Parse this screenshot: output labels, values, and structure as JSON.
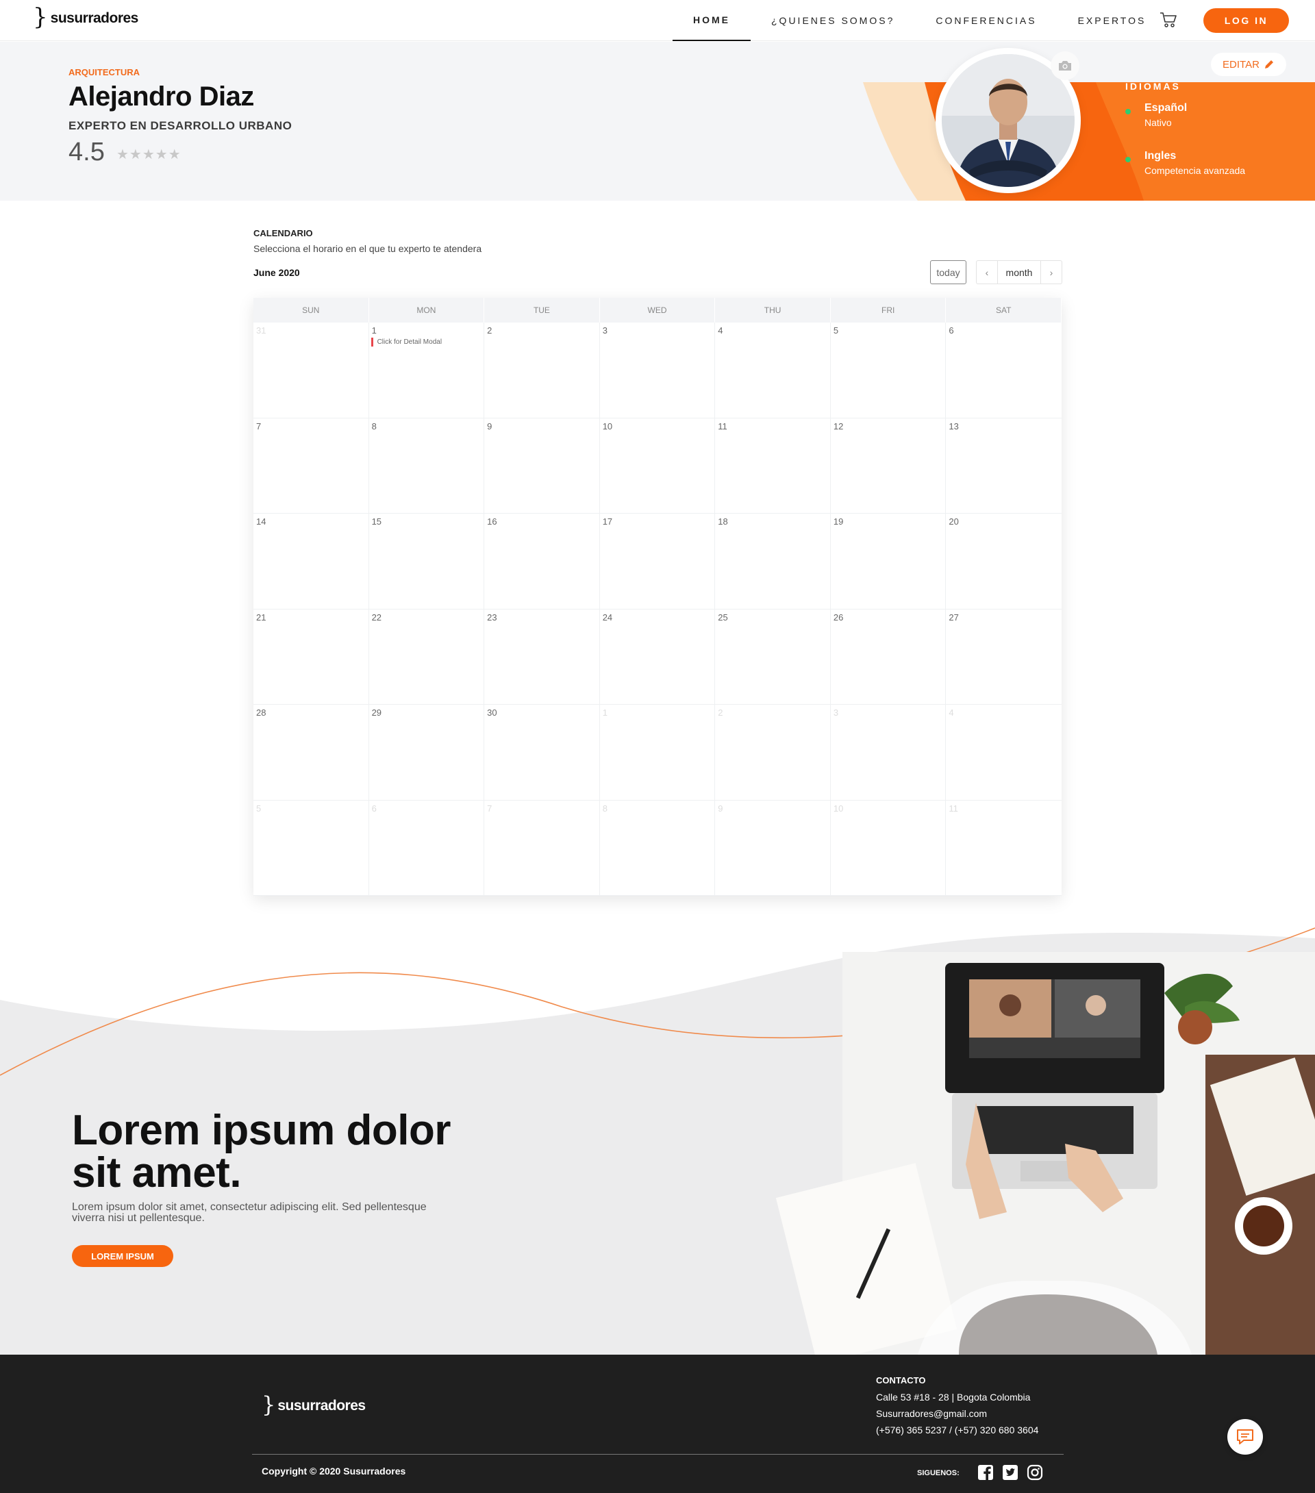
{
  "brand": {
    "name": "susurradores",
    "mark": "}"
  },
  "nav": {
    "items": [
      {
        "label": "HOME",
        "active": true
      },
      {
        "label": "¿QUIENES SOMOS?",
        "active": false
      },
      {
        "label": "CONFERENCIAS",
        "active": false
      },
      {
        "label": "EXPERTOS",
        "active": false
      }
    ],
    "cart_icon": "shopping-cart-icon",
    "login_label": "LOG IN"
  },
  "profile": {
    "category": "ARQUITECTURA",
    "name": "Alejandro Diaz",
    "title": "EXPERTO EN DESARROLLO URBANO",
    "rating": "4.5",
    "stars": "★★★★★",
    "edit_label": "EDITAR",
    "languages_title": "IDIOMAS",
    "languages": [
      {
        "name": "Español",
        "level": "Nativo"
      },
      {
        "name": "Ingles",
        "level": "Competencia avanzada"
      }
    ]
  },
  "calendar": {
    "heading": "CALENDARIO",
    "subtitle": "Selecciona el horario en el que tu experto te atendera",
    "month_label": "June 2020",
    "today_label": "today",
    "view_label": "month",
    "prev_icon": "chevron-left-icon",
    "next_icon": "chevron-right-icon",
    "weekdays": [
      "SUN",
      "MON",
      "TUE",
      "WED",
      "THU",
      "FRI",
      "SAT"
    ],
    "weeks": [
      [
        "31",
        "1",
        "2",
        "3",
        "4",
        "5",
        "6"
      ],
      [
        "7",
        "8",
        "9",
        "10",
        "11",
        "12",
        "13"
      ],
      [
        "14",
        "15",
        "16",
        "17",
        "18",
        "19",
        "20"
      ],
      [
        "21",
        "22",
        "23",
        "24",
        "25",
        "26",
        "27"
      ],
      [
        "28",
        "29",
        "30",
        "1",
        "2",
        "3",
        "4"
      ],
      [
        "5",
        "6",
        "7",
        "8",
        "9",
        "10",
        "11"
      ]
    ],
    "event": {
      "label": "Click for Detail Modal",
      "color": "#e8474c"
    }
  },
  "promo": {
    "title_line1": "Lorem ipsum dolor",
    "title_line2": "sit amet.",
    "text": "Lorem ipsum dolor sit amet, consectetur adipiscing elit. Sed pellentesque viverra nisi ut pellentesque.",
    "button_label": "LOREM IPSUM"
  },
  "footer": {
    "contact_title": "CONTACTO",
    "address": "Calle 53 #18 - 28 | Bogota Colombia",
    "email": "Susurradores@gmail.com",
    "phone": "(+576) 365 5237 / (+57) 320 680 3604",
    "copyright": "Copyright © 2020 Susurradores",
    "follow_label": "SIGUENOS:",
    "social_icons": [
      "facebook-icon",
      "twitter-icon",
      "instagram-icon"
    ]
  },
  "colors": {
    "accent": "#f7650f",
    "accent_light": "#fbd3a8",
    "footer_bg": "#1f1f1f",
    "banner_bg": "#f4f5f7"
  }
}
